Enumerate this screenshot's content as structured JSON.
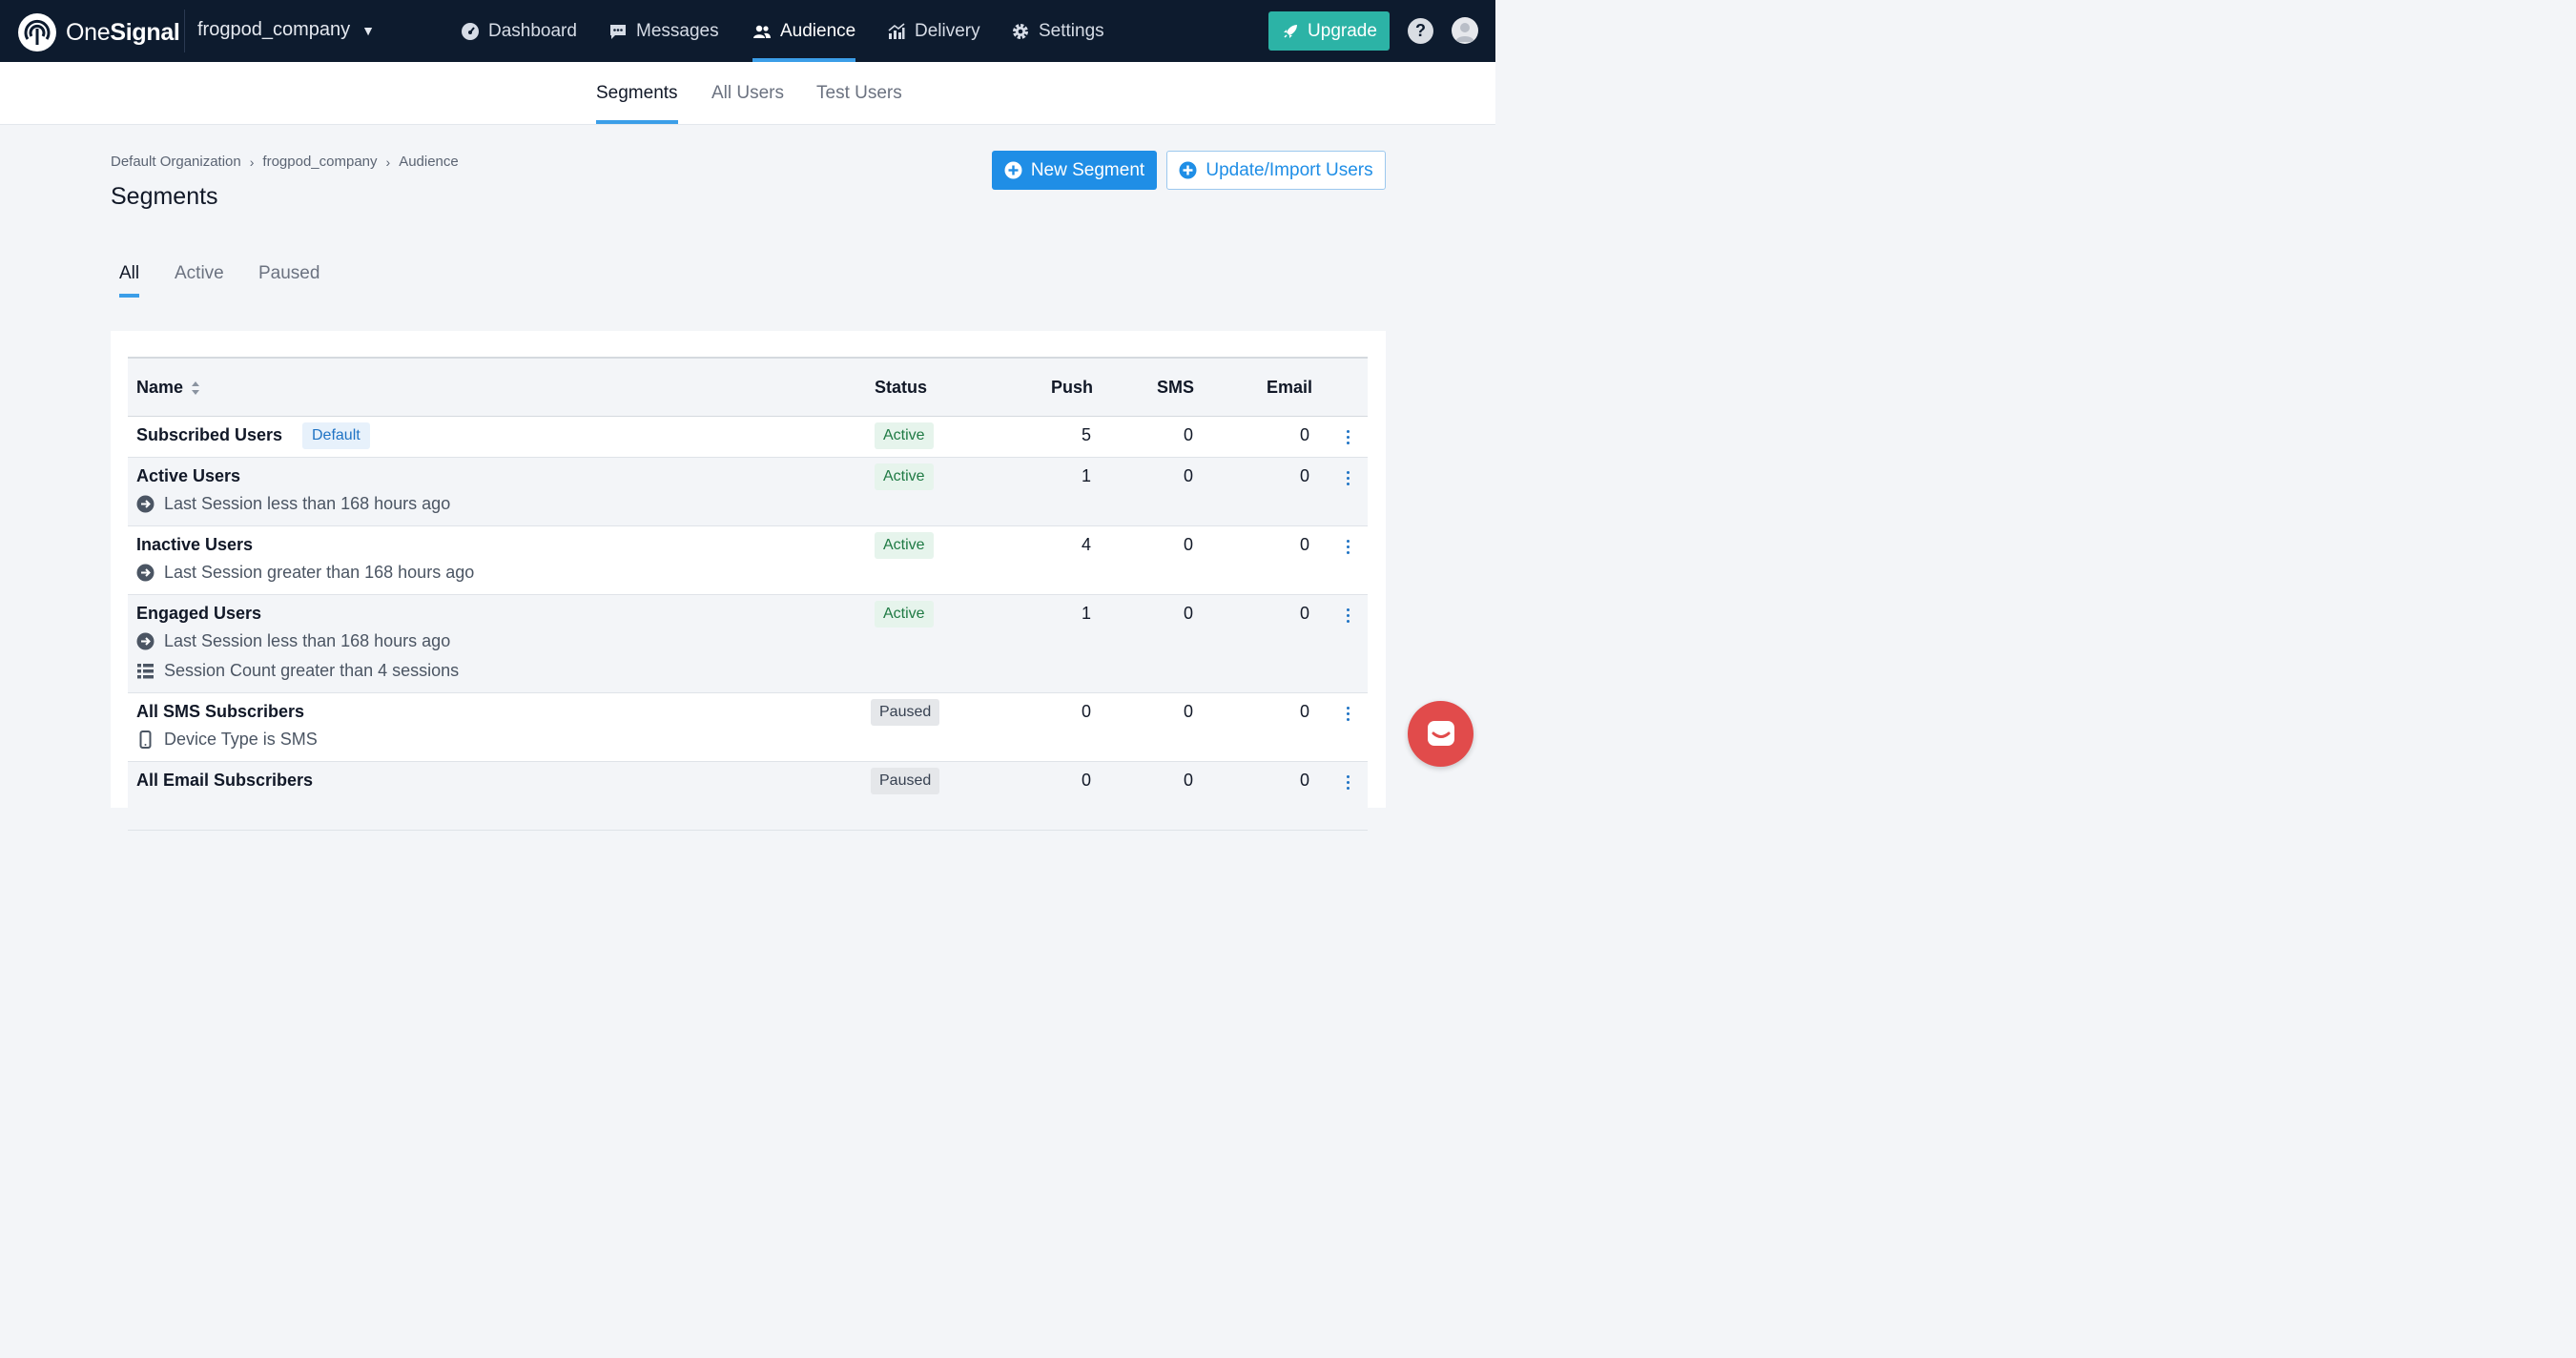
{
  "brand": {
    "name_part1": "One",
    "name_part2": "Signal"
  },
  "app": {
    "selected": "frogpod_company"
  },
  "nav": {
    "items": [
      {
        "label": "Dashboard",
        "icon": "dashboard-gauge-icon"
      },
      {
        "label": "Messages",
        "icon": "chat-bubble-icon"
      },
      {
        "label": "Audience",
        "icon": "users-icon",
        "active": true
      },
      {
        "label": "Delivery",
        "icon": "bar-chart-icon"
      },
      {
        "label": "Settings",
        "icon": "gear-icon"
      }
    ],
    "upgrade_label": "Upgrade",
    "help_label": "?"
  },
  "subnav": {
    "tabs": [
      {
        "label": "Segments",
        "active": true
      },
      {
        "label": "All Users"
      },
      {
        "label": "Test Users"
      }
    ]
  },
  "breadcrumb": [
    "Default Organization",
    "frogpod_company",
    "Audience"
  ],
  "page": {
    "title": "Segments",
    "new_segment_label": "New Segment",
    "import_label": "Update/Import Users"
  },
  "filters": {
    "tabs": [
      {
        "label": "All",
        "active": true
      },
      {
        "label": "Active"
      },
      {
        "label": "Paused"
      }
    ]
  },
  "table": {
    "headers": {
      "name": "Name",
      "status": "Status",
      "push": "Push",
      "sms": "SMS",
      "email": "Email"
    },
    "rows": [
      {
        "name": "Subscribed Users",
        "badge": "Default",
        "status": "Active",
        "push": "5",
        "sms": "0",
        "email": "0",
        "rules": []
      },
      {
        "name": "Active Users",
        "status": "Active",
        "push": "1",
        "sms": "0",
        "email": "0",
        "rules": [
          {
            "icon": "arrow-circle-icon",
            "text": "Last Session less than 168 hours ago"
          }
        ]
      },
      {
        "name": "Inactive Users",
        "status": "Active",
        "push": "4",
        "sms": "0",
        "email": "0",
        "rules": [
          {
            "icon": "arrow-circle-icon",
            "text": "Last Session greater than 168 hours ago"
          }
        ]
      },
      {
        "name": "Engaged Users",
        "status": "Active",
        "push": "1",
        "sms": "0",
        "email": "0",
        "rules": [
          {
            "icon": "arrow-circle-icon",
            "text": "Last Session less than 168 hours ago"
          },
          {
            "icon": "list-icon",
            "text": "Session Count greater than 4 sessions"
          }
        ]
      },
      {
        "name": "All SMS Subscribers",
        "status": "Paused",
        "push": "0",
        "sms": "0",
        "email": "0",
        "rules": [
          {
            "icon": "phone-icon",
            "text": "Device Type is SMS"
          }
        ]
      },
      {
        "name": "All Email Subscribers",
        "status": "Paused",
        "push": "0",
        "sms": "0",
        "email": "0",
        "rules": []
      }
    ]
  },
  "colors": {
    "topbar": "#0d1b2e",
    "accent": "#1f8ee6",
    "upgrade": "#2cb3a6",
    "chat": "#e14b4b"
  }
}
